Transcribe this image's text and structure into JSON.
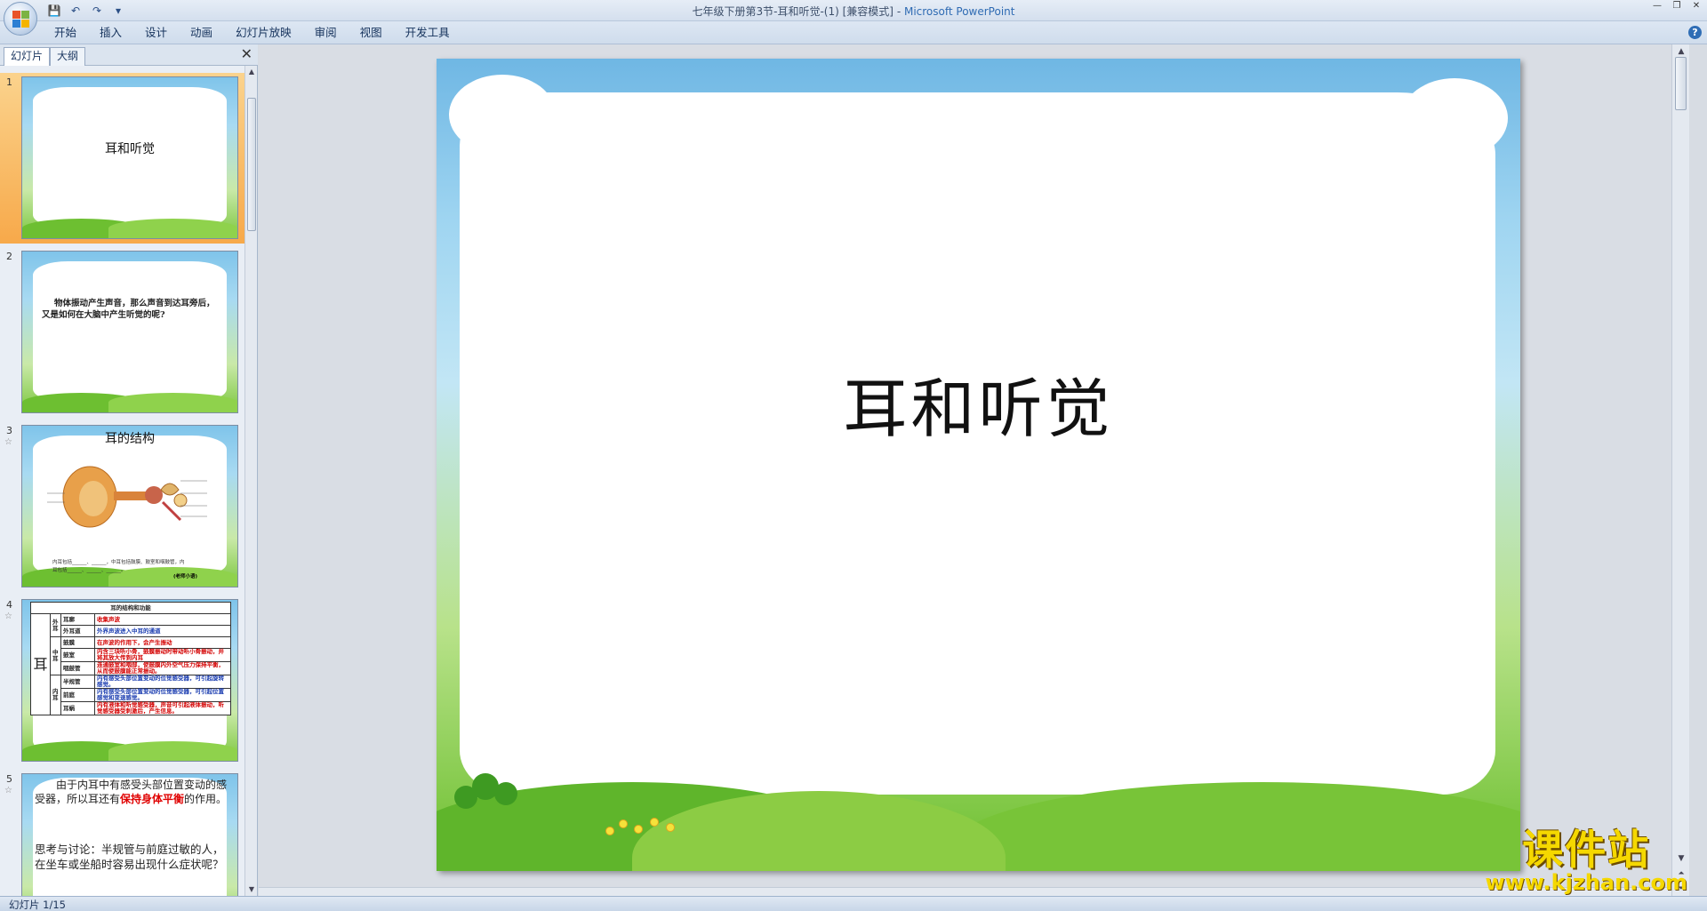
{
  "window": {
    "doc_name": "七年级下册第3节-耳和听觉-(1) [兼容模式]",
    "separator": " - ",
    "app_name": "Microsoft PowerPoint"
  },
  "ribbon": {
    "tabs": [
      "开始",
      "插入",
      "设计",
      "动画",
      "幻灯片放映",
      "审阅",
      "视图",
      "开发工具"
    ]
  },
  "panel": {
    "tab_slides": "幻灯片",
    "tab_outline": "大纲",
    "close": "✕"
  },
  "slides": [
    {
      "num": "1",
      "title": "耳和听觉"
    },
    {
      "num": "2",
      "text": "物体振动产生声音，那么声音到达耳旁后，又是如何在大脑中产生听觉的呢?"
    },
    {
      "num": "3",
      "title": "耳的结构",
      "caption_left": "内耳包括______、______，中耳包括鼓膜、鼓室和咽鼓管，内耳包括______、______、______。",
      "caption_right": "(老师小语)"
    },
    {
      "num": "4",
      "table_title": "耳的结构和功能",
      "ear_label": "耳",
      "rows": [
        {
          "group": "外耳",
          "part": "耳廓",
          "func": "收集声波",
          "color": "red"
        },
        {
          "group": "",
          "part": "外耳道",
          "func": "外界声波进入中耳的通道",
          "color": "blue"
        },
        {
          "group": "中耳",
          "part": "鼓膜",
          "func": "在声波的作用下，会产生振动",
          "color": "red"
        },
        {
          "group": "",
          "part": "鼓室",
          "func": "内含三块听小骨，鼓膜振动时带动听小骨振动，并将其放大传到内耳",
          "color": "red"
        },
        {
          "group": "",
          "part": "咽鼓管",
          "func": "连通鼓室和咽部，使鼓膜内外空气压力保持平衡，从而使鼓膜能正常振动。",
          "color": "red"
        },
        {
          "group": "内耳",
          "part": "半规管",
          "func": "内有感受头部位置变动的位觉感受器，可引起旋转感觉。",
          "color": "blue"
        },
        {
          "group": "",
          "part": "前庭",
          "func": "内有感受头部位置变动的位觉感受器，可引起位置感觉和变速感觉。",
          "color": "blue"
        },
        {
          "group": "",
          "part": "耳蜗",
          "func": "内有液体和听觉感受器，声音可引起液体振动，听觉感受器受刺激后，产生信息。",
          "color": "red"
        }
      ]
    },
    {
      "num": "5",
      "para1_a": "由于内耳中有感受头部位置变动的感受器，所以耳还有",
      "para1_b": "保持身体平衡",
      "para1_c": "的作用。",
      "para2": "思考与讨论：半规管与前庭过敏的人，在坐车或坐船时容易出现什么症状呢？"
    }
  ],
  "main_slide": {
    "title": "耳和听觉"
  },
  "status": {
    "text": "幻灯片 1/15"
  },
  "watermark": {
    "cn": "课件站",
    "url": "www.kjzhan.com"
  },
  "colors": {
    "accent_selected": "#f7a94a",
    "sky": "#7fc4ea",
    "grass": "#6cbf2e",
    "watermark": "#f5d800"
  }
}
